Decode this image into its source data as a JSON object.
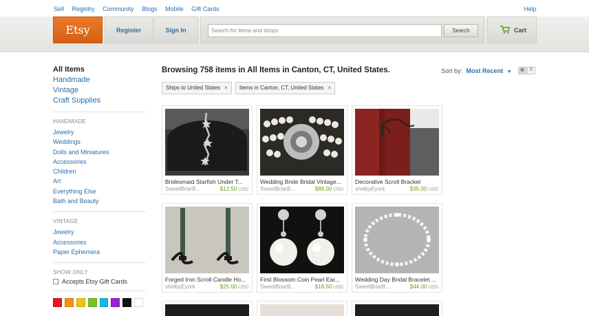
{
  "toplinks": [
    "Sell",
    "Registry",
    "Community",
    "Blogs",
    "Mobile",
    "Gift Cards"
  ],
  "help": "Help",
  "header": {
    "logo": "Etsy",
    "register": "Register",
    "signin": "Sign In",
    "search_placeholder": "Search for items and shops",
    "search_button": "Search",
    "cart": "Cart"
  },
  "sidebar": {
    "main": [
      "All Items",
      "Handmade",
      "Vintage",
      "Craft Supplies"
    ],
    "handmade_head": "HANDMADE",
    "handmade": [
      "Jewelry",
      "Weddings",
      "Dolls and Miniatures",
      "Accessories",
      "Children",
      "Art",
      "Everything Else",
      "Bath and Beauty"
    ],
    "vintage_head": "VINTAGE",
    "vintage": [
      "Jewelry",
      "Accessories",
      "Paper Ephemera"
    ],
    "showonly_head": "SHOW ONLY",
    "showonly_option": "Accepts Etsy Gift Cards",
    "swatches": [
      "#e8141b",
      "#f39217",
      "#f2c40f",
      "#7ac41b",
      "#17b8e0",
      "#9c1fd6",
      "#111111",
      "#ffffff"
    ]
  },
  "main": {
    "title": "Browsing 758 items in All Items in Canton, CT, United States.",
    "sort_label": "Sort by:",
    "sort_value": "Most Recent",
    "filters": [
      "Ships to United States",
      "Items in Canton, CT, United States"
    ],
    "remove_glyph": "×"
  },
  "listings": [
    {
      "title": "Bridesmaid Starfish Under T...",
      "seller": "SweetBriarB...",
      "price": "$12.50",
      "currency": "USD"
    },
    {
      "title": "Wedding Bride Bridal Vintage...",
      "seller": "SweetBriarB...",
      "price": "$88.00",
      "currency": "USD"
    },
    {
      "title": "Decorative Scroll Bracket",
      "seller": "shelbyEyork",
      "price": "$35.00",
      "currency": "USD"
    },
    {
      "title": "Forged Iron Scroll Candle Ho...",
      "seller": "shelbyEyork",
      "price": "$25.00",
      "currency": "USD"
    },
    {
      "title": "First Blossom Coin Pearl Ear...",
      "seller": "SweetBriarB...",
      "price": "$18.50",
      "currency": "USD"
    },
    {
      "title": "Wedding Day Bridal Bracelet ...",
      "seller": "SweetBriarB...",
      "price": "$44.00",
      "currency": "USD"
    }
  ]
}
